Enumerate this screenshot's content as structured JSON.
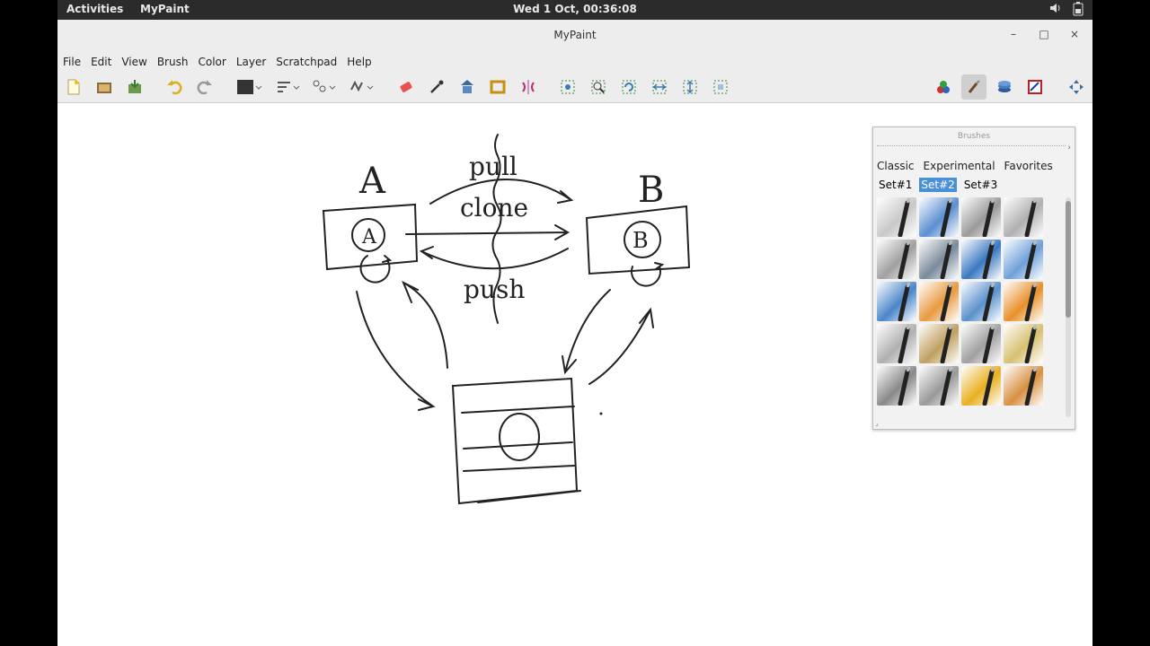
{
  "gnome_bar": {
    "activities": "Activities",
    "app_name": "MyPaint",
    "clock": "Wed  1 Oct, 00:36:08",
    "volume_icon": "speaker-icon",
    "battery_icon": "battery-icon"
  },
  "window": {
    "title": "MyPaint",
    "minimize": "–",
    "maximize": "□",
    "close": "×"
  },
  "menu": [
    "File",
    "Edit",
    "View",
    "Brush",
    "Color",
    "Layer",
    "Scratchpad",
    "Help"
  ],
  "toolbar_icons": [
    "new-document-icon",
    "open-file-icon",
    "save-file-icon",
    "undo-icon",
    "redo-icon",
    "color-swatch-icon",
    "brush-size-icon",
    "brush-opacity-icon",
    "brush-modifiers-icon",
    "eraser-icon",
    "color-picker-icon",
    "pan-icon",
    "frame-icon",
    "symmetry-icon",
    "zoom-fit-icon",
    "zoom-icon",
    "rotate-icon",
    "flip-horizontal-icon",
    "flip-vertical-icon",
    "fullscreen-icon",
    "color-panel-icon",
    "brush-panel-icon",
    "layers-panel-icon",
    "scratchpad-panel-icon",
    "move-panel-icon"
  ],
  "canvas_sketch": {
    "label_a": "A",
    "label_b": "B",
    "node_a": "A",
    "node_b": "B",
    "arrow_pull": "pull",
    "arrow_clone": "clone",
    "arrow_push": "push"
  },
  "brushes_panel": {
    "title": "Brushes",
    "tabs": [
      "Classic",
      "Experimental",
      "Favorites"
    ],
    "sets": [
      "Set#1",
      "Set#2",
      "Set#3"
    ],
    "selected_set": "Set#2",
    "brush_colors": [
      "#c8c8c8",
      "#5a8fd0",
      "#9a9a9a",
      "#b0b0b0",
      "#a0a0a0",
      "#7a8a9a",
      "#3a78c0",
      "#6ea0d8",
      "#4a86c8",
      "#e89a40",
      "#5a90cc",
      "#e8902a",
      "#b0b0b0",
      "#c0a060",
      "#a0a0a0",
      "#d8c070",
      "#888888",
      "#999999",
      "#e8b020",
      "#d89040"
    ]
  }
}
